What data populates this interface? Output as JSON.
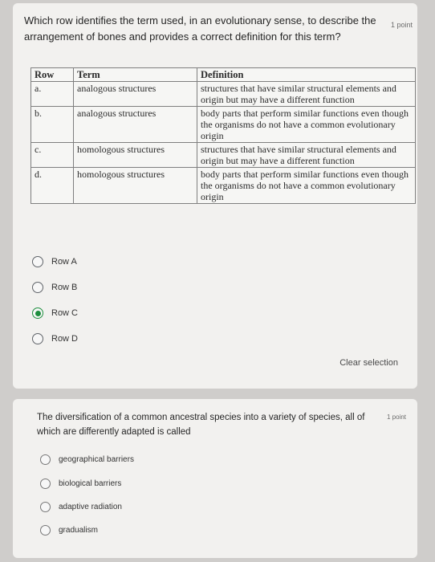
{
  "q1": {
    "question": "Which row identifies the term used, in an evolutionary sense, to describe the arrangement of bones and provides a correct definition for this term?",
    "points": "1 point",
    "table": {
      "headers": [
        "Row",
        "Term",
        "Definition"
      ],
      "rows": [
        {
          "row": "a.",
          "term": "analogous structures",
          "definition": "structures that have similar structural elements and origin but may have a different function"
        },
        {
          "row": "b.",
          "term": "analogous structures",
          "definition": "body parts that perform similar functions even though the organisms do not have a common evolutionary origin"
        },
        {
          "row": "c.",
          "term": "homologous structures",
          "definition": "structures that have similar structural elements and origin but may have a different function"
        },
        {
          "row": "d.",
          "term": "homologous structures",
          "definition": "body parts that perform similar functions even though the organisms do not have a common evolutionary origin"
        }
      ]
    },
    "options": [
      "Row A",
      "Row B",
      "Row C",
      "Row D"
    ],
    "selected": "Row C",
    "clear_label": "Clear selection"
  },
  "q2": {
    "question": "The diversification of a common ancestral species into a variety of species, all of which are differently adapted is called",
    "points": "1 point",
    "options": [
      "geographical barriers",
      "biological barriers",
      "adaptive radiation",
      "gradualism"
    ]
  },
  "colors": {
    "selected_radio": "#1e8e3e",
    "card_bg": "#f2f1ef"
  }
}
